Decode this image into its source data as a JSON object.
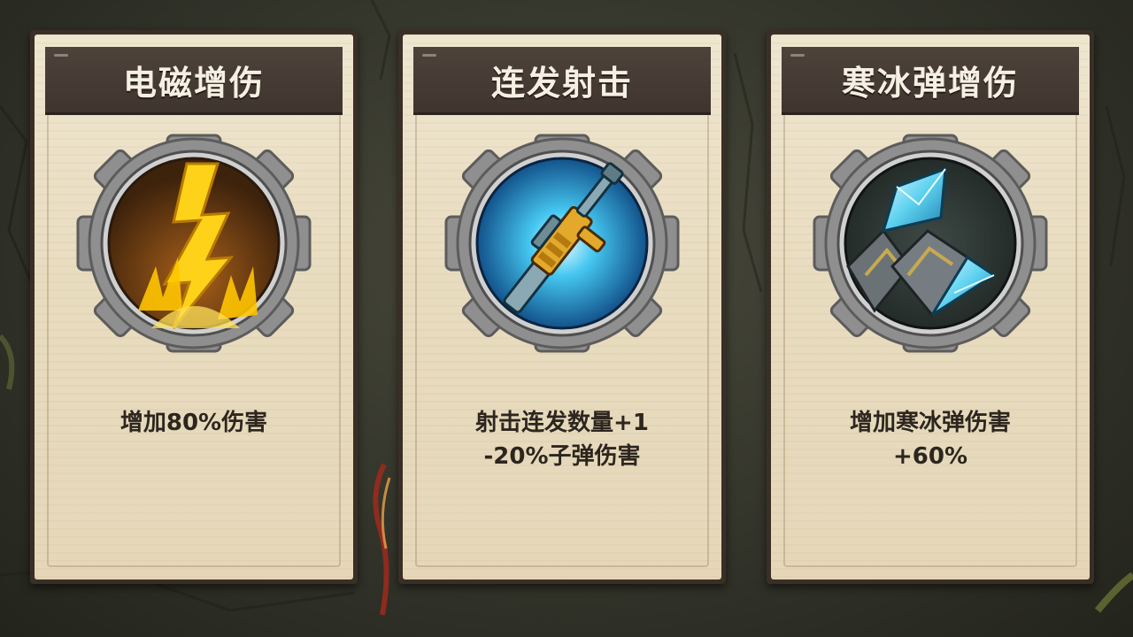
{
  "cards": [
    {
      "title": "电磁增伤",
      "icon": "lightning-icon",
      "desc": [
        "增加80%伤害"
      ]
    },
    {
      "title": "连发射击",
      "icon": "rifle-icon",
      "desc": [
        "射击连发数量+1",
        "-20%子弹伤害"
      ]
    },
    {
      "title": "寒冰弹增伤",
      "icon": "ice-crystal-icon",
      "desc": [
        "增加寒冰弹伤害",
        "+60%"
      ]
    }
  ],
  "colors": {
    "card_paper": "#e8dcc0",
    "title_bar": "#4a3f37",
    "title_text": "#f6efe3",
    "desc_text": "#2d261f",
    "gear": "#9c9c9c"
  }
}
